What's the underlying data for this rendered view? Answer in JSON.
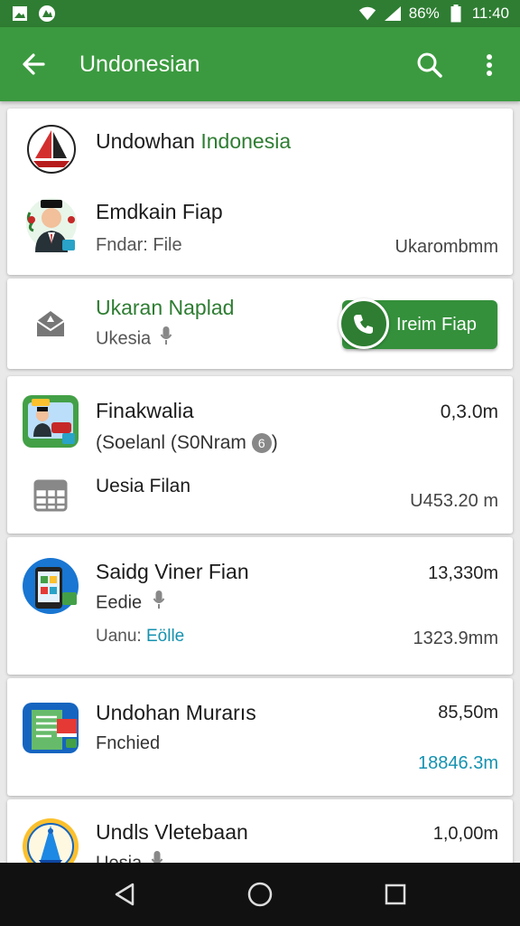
{
  "status": {
    "battery": "86%",
    "time": "11:40"
  },
  "app": {
    "title": "Undonesian"
  },
  "colors": {
    "primary": "#3b9a3f",
    "primary_dark": "#2e7d32",
    "accent_blue": "#1592b0"
  },
  "cards": [
    {
      "title_a": "Undowhan ",
      "title_b": "Indonesia",
      "name": "Emdkain Fiap",
      "sub": "Fndar: File",
      "right": "Ukarombmm",
      "icons": [
        "sailboat-icon",
        "person-avatar-icon"
      ]
    },
    {
      "name": "Ukaran Naplad",
      "sub": "Ukesia",
      "button_label": "Ireim Fiap",
      "icons": [
        "mail-icon",
        "mic-icon",
        "phone-icon"
      ]
    },
    {
      "name": "Finakwalia",
      "sub": "(Soelanl (S0Nram",
      "badge": "6",
      "right_top": "0,3.0m",
      "row2_name": "Uesia Filan",
      "row2_right": "U453.20 m",
      "icons": [
        "folder-avatar-icon",
        "table-icon"
      ]
    },
    {
      "name": "Saidg Viner Fian",
      "sub": "Eedie",
      "sub2_a": "Uanu: ",
      "sub2_b": "Eölle",
      "right_top": "13,330m",
      "right_bottom": "1323.9mm",
      "icons": [
        "phone-app-icon",
        "mic-icon"
      ]
    },
    {
      "name": "Undohan Murarıs",
      "sub": "Fnchied",
      "right_top": "85,50m",
      "right_bottom": "18846.3m",
      "icons": [
        "document-icon"
      ]
    },
    {
      "name": "Undls Vletebaan",
      "sub": "Uesia",
      "right_top": "1,0,00m",
      "icons": [
        "emblem-icon",
        "mic-icon"
      ]
    }
  ]
}
